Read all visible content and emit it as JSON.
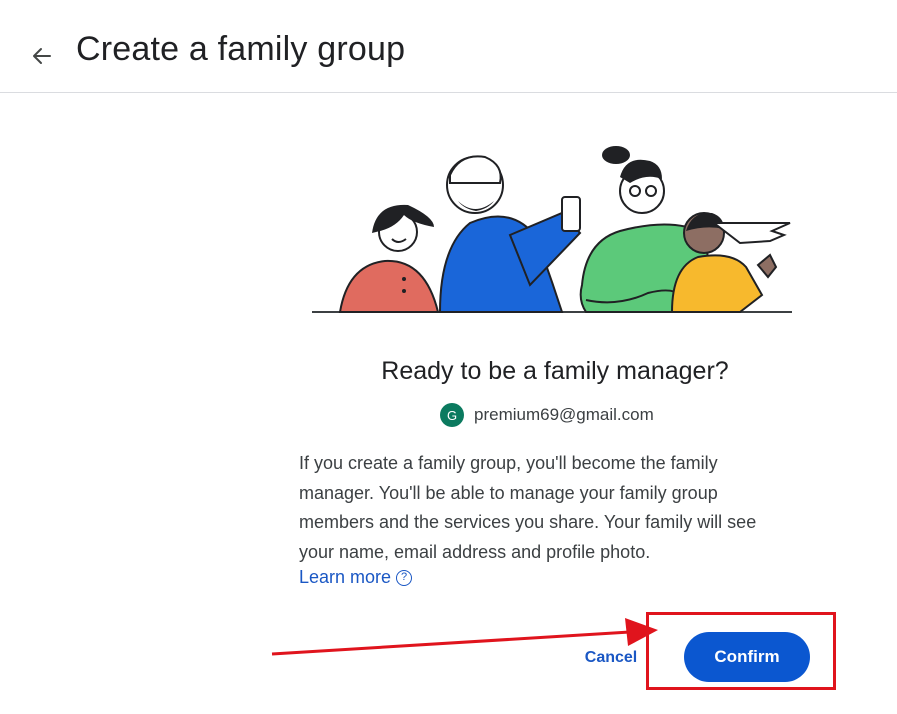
{
  "header": {
    "title": "Create a family group",
    "back_icon": "arrow-back-icon"
  },
  "main": {
    "headline": "Ready to be a family manager?",
    "account": {
      "avatar_letter": "G",
      "avatar_color": "#0b7a5f",
      "email": "premium69@gmail.com"
    },
    "description": "If you create a family group, you'll become the family manager. You'll be able to manage your family group members and the services you share. Your family will see your name, email address and profile photo.",
    "learn_more": "Learn more",
    "help_icon_glyph": "?"
  },
  "actions": {
    "cancel_label": "Cancel",
    "confirm_label": "Confirm",
    "accent_color": "#0b57d0"
  },
  "annotation": {
    "color": "#e0141d"
  }
}
